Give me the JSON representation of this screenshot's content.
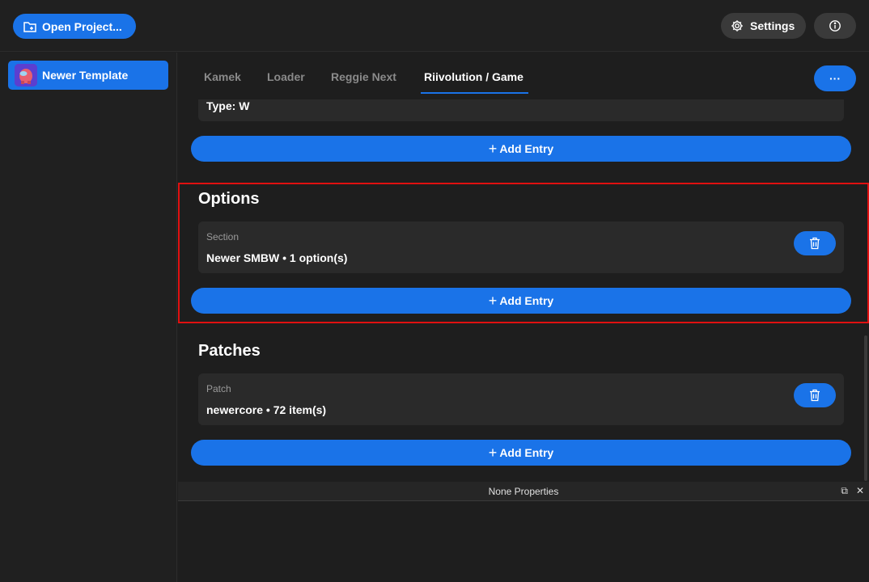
{
  "toolbar": {
    "open_project_label": "Open Project...",
    "settings_label": "Settings"
  },
  "sidebar": {
    "items": [
      {
        "label": "Newer Template",
        "icon": "project-icon"
      }
    ]
  },
  "tabs": [
    {
      "label": "Kamek",
      "active": false
    },
    {
      "label": "Loader",
      "active": false
    },
    {
      "label": "Reggie Next",
      "active": false
    },
    {
      "label": "Riivolution / Game",
      "active": true
    }
  ],
  "more_label": "···",
  "top_card": {
    "value": "Type: W"
  },
  "add_entry_label": "Add Entry",
  "options": {
    "title": "Options",
    "entries": [
      {
        "label": "Section",
        "value": "Newer SMBW • 1 option(s)"
      }
    ]
  },
  "patches": {
    "title": "Patches",
    "entries": [
      {
        "label": "Patch",
        "value": "newercore • 72 item(s)"
      }
    ]
  },
  "properties_panel": {
    "title": "None Properties"
  },
  "colors": {
    "accent": "#1a73e8",
    "highlight": "#e01010",
    "background": "#1e1e1e"
  }
}
